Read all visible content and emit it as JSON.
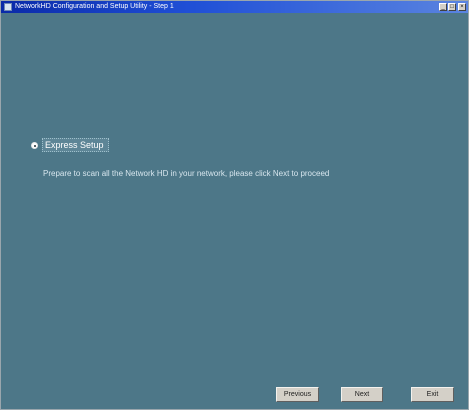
{
  "window": {
    "title": "NetworkHD Configuration and Setup Utility - Step 1",
    "controls": {
      "minimize": "_",
      "maximize": "□",
      "close": "×"
    }
  },
  "setup": {
    "option_label": "Express Setup",
    "option_selected": true,
    "description": "Prepare to scan all the Network HD in your network, please click Next to proceed"
  },
  "buttons": {
    "previous": "Previous",
    "next": "Next",
    "exit": "Exit"
  },
  "colors": {
    "background": "#4d7788",
    "titlebar": "#1f4fd6"
  }
}
